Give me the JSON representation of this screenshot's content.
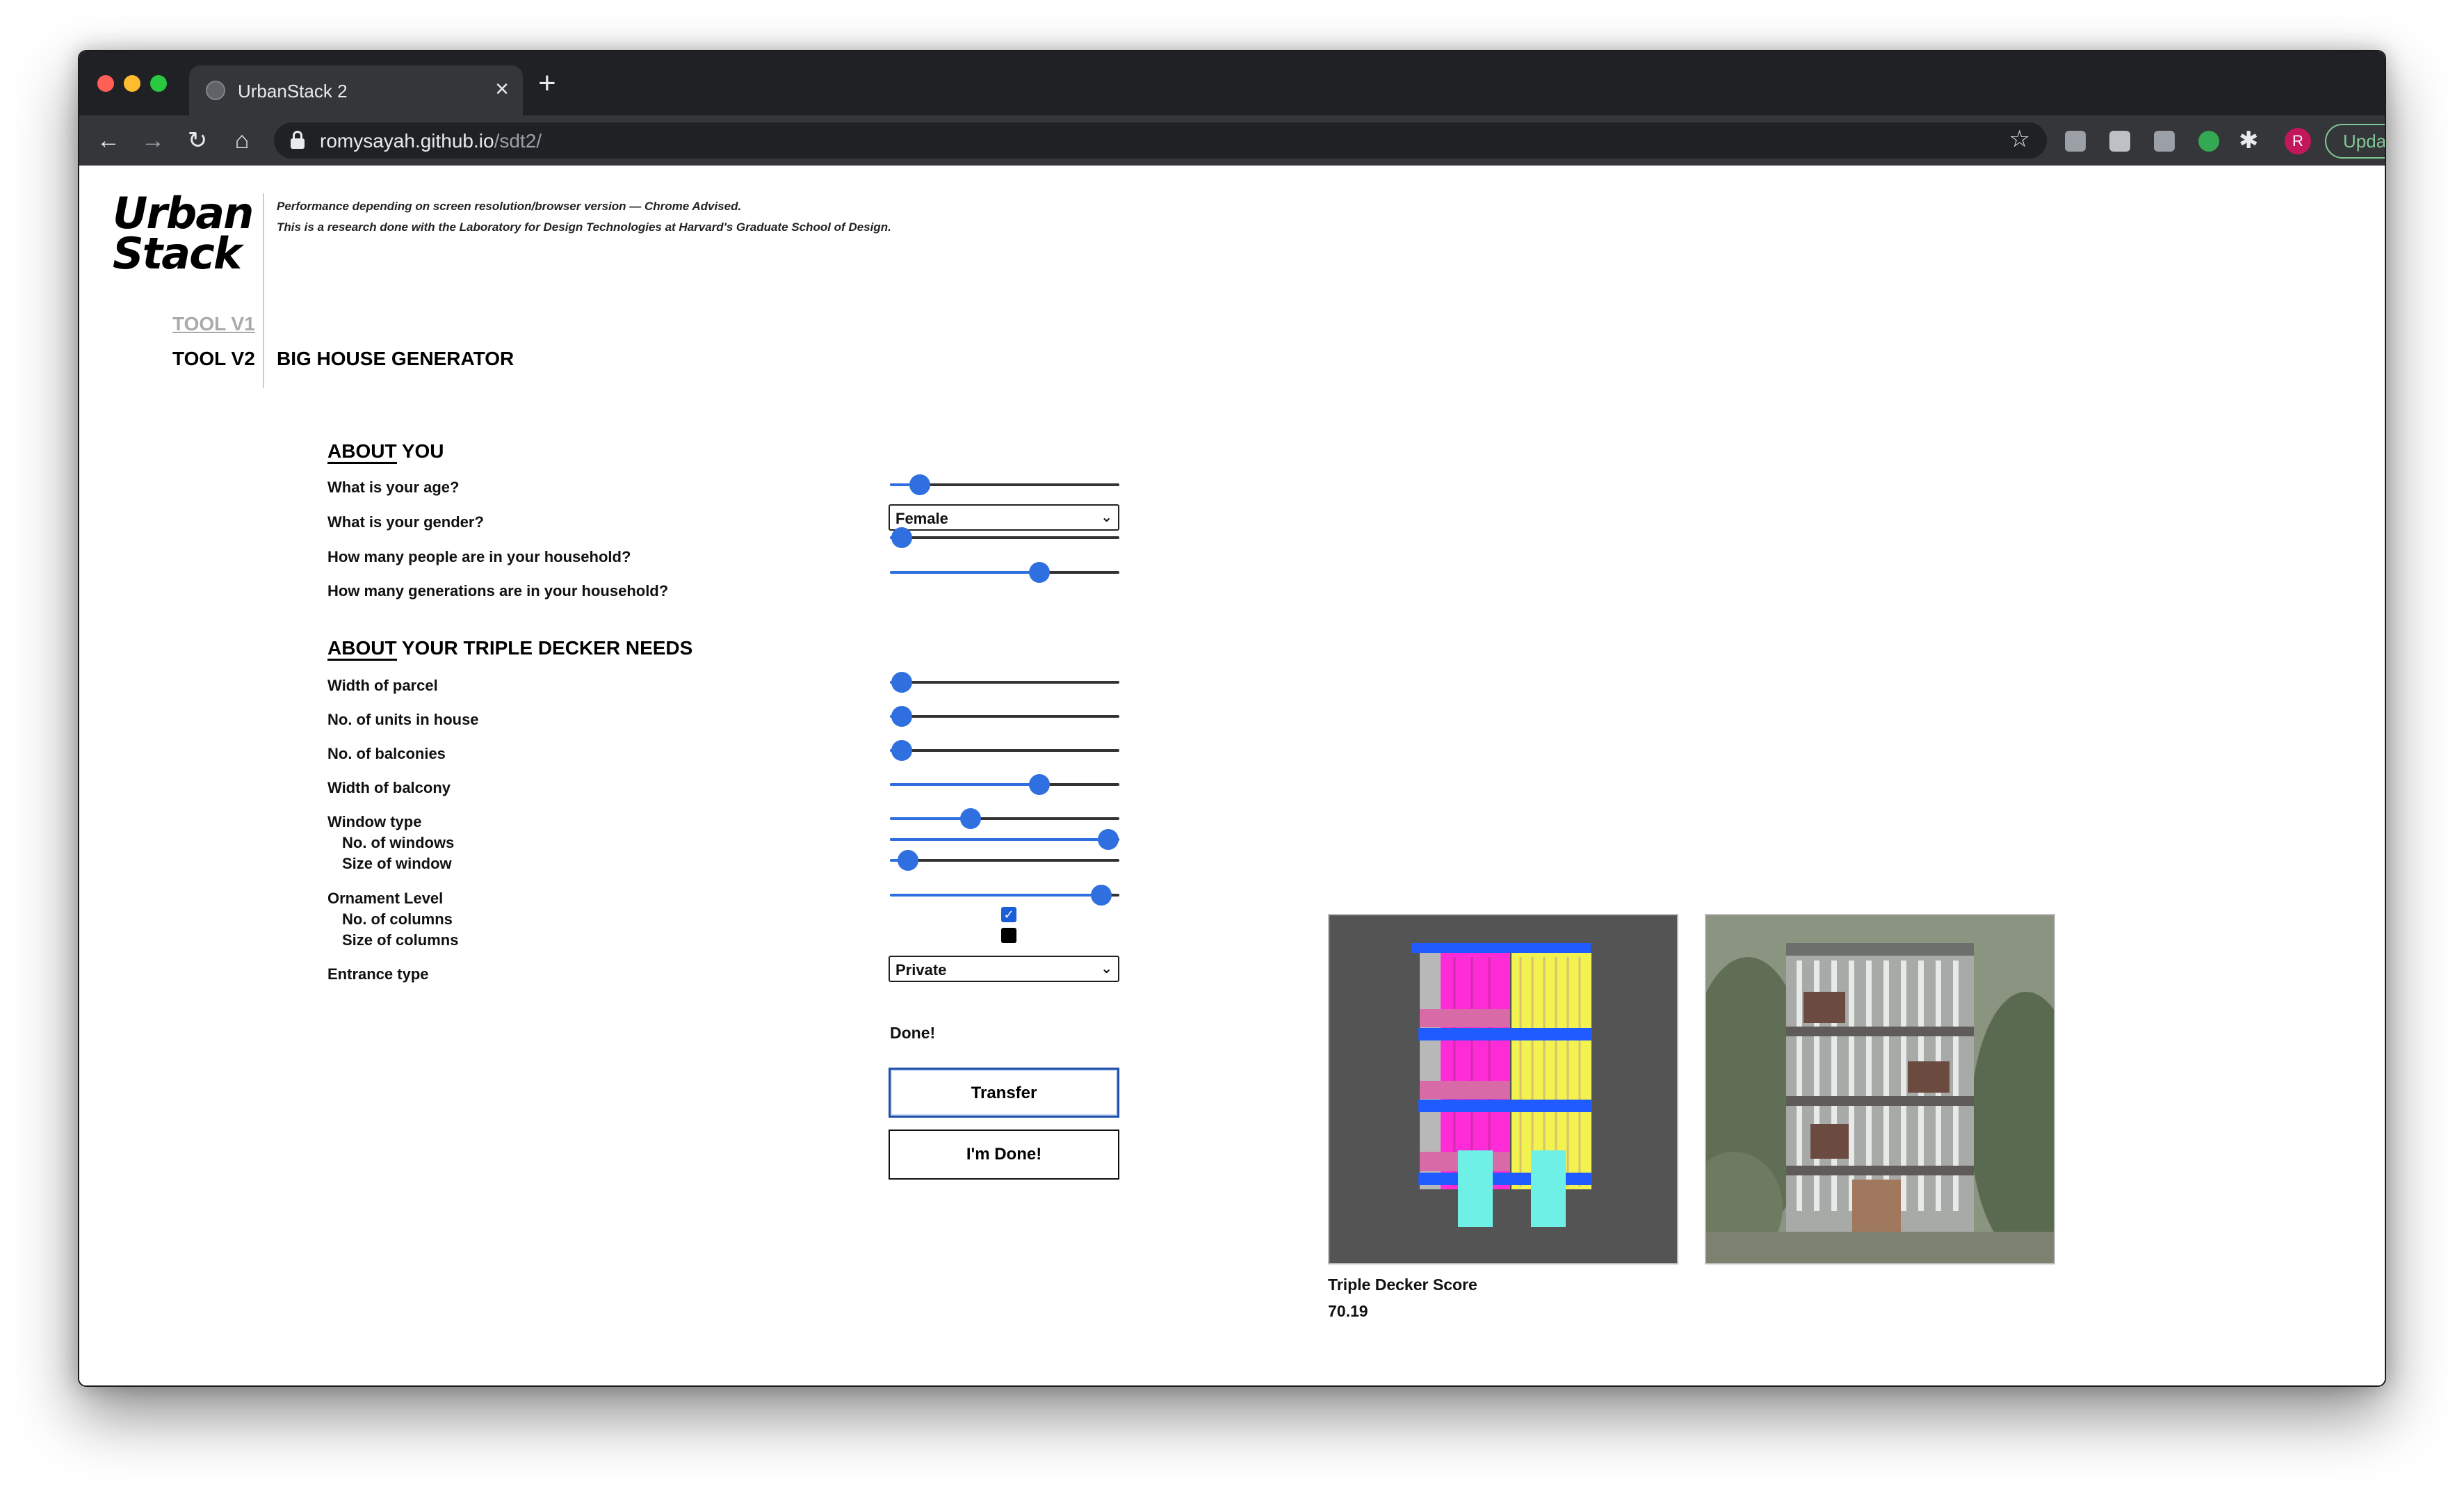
{
  "browser": {
    "tab_title": "UrbanStack 2",
    "url_host": "romysayah.github.io",
    "url_path": "/sdt2/",
    "update_label": "Update",
    "avatar_letter": "R"
  },
  "header": {
    "logo_line1": "Urban",
    "logo_line2": "Stack",
    "disclaimer_line1": "Performance depending on screen resolution/browser version — Chrome Advised.",
    "disclaimer_line2": "This is a research done with the Laboratory for Design Technologies at Harvard's Graduate School of Design.",
    "tool_v1": "TOOL V1",
    "tool_v2": "TOOL V2",
    "page_heading": "BIG HOUSE GENERATOR"
  },
  "about_you": {
    "title_underlined": "ABOUT",
    "title_rest": " YOU",
    "questions": [
      "What is your age?",
      "What is your gender?",
      "How many people are in your household?",
      "How many generations are in your household?"
    ],
    "gender_value": "Female",
    "age_level": 0.13,
    "household_people_level": 0.05,
    "generations_level": 0.65
  },
  "needs": {
    "title_underlined": "ABOUT",
    "title_rest": " YOUR TRIPLE DECKER NEEDS",
    "questions": {
      "width_of_parcel": "Width of parcel",
      "units_in_house": "No. of units in house",
      "balconies": "No. of balconies",
      "width_of_balcony": "Width of balcony",
      "window_type": "Window type",
      "no_of_windows": "No. of windows",
      "size_of_window": "Size of window",
      "ornament_level": "Ornament Level",
      "no_of_columns": "No. of columns",
      "size_of_columns": "Size of columns",
      "entrance_type": "Entrance type"
    },
    "levels": {
      "width_of_parcel": 0.05,
      "units_in_house": 0.05,
      "balconies": 0.05,
      "width_of_balcony": 0.65,
      "window_type": 0.35,
      "no_of_windows": 0.95,
      "size_of_window": 0.08,
      "ornament_level": 0.92
    },
    "no_of_columns_checked": true,
    "size_of_columns_checked": false,
    "entrance_value": "Private"
  },
  "actions": {
    "status": "Done!",
    "transfer_label": "Transfer",
    "done_label": "I'm Done!"
  },
  "result": {
    "score_label": "Triple Decker Score",
    "score_value": "70.19"
  },
  "colors": {
    "accent": "#2f6fe0",
    "magenta": "#ff2bd6",
    "yellow": "#f2f251",
    "cyan": "#6ff0e6",
    "blue": "#1f5bff"
  }
}
